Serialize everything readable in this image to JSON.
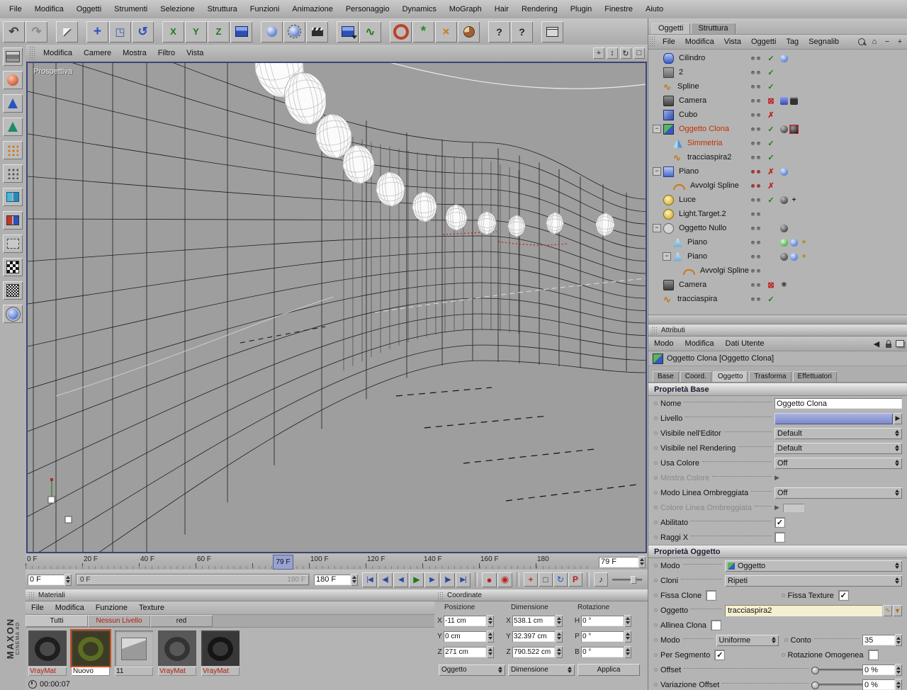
{
  "menubar": {
    "items": [
      "File",
      "Modifica",
      "Oggetti",
      "Strumenti",
      "Selezione",
      "Struttura",
      "Funzioni",
      "Animazione",
      "Personaggio",
      "Dynamics",
      "MoGraph",
      "Hair",
      "Rendering",
      "Plugin",
      "Finestre",
      "Aiuto"
    ]
  },
  "toolbar": {
    "buttons": [
      {
        "name": "undo",
        "glyph": "↶",
        "icon": "",
        "sep": "0"
      },
      {
        "name": "redo",
        "glyph": "↷",
        "icon": "",
        "sep": "0"
      },
      {
        "name": "select-tool",
        "glyph": "◤",
        "icon": "",
        "sep": "1"
      },
      {
        "name": "move-tool",
        "glyph": "+",
        "icon": "",
        "sep": "1"
      },
      {
        "name": "scale-tool",
        "glyph": "◳",
        "icon": "",
        "sep": "0"
      },
      {
        "name": "rotate-tool",
        "glyph": "↺",
        "icon": "",
        "sep": "0"
      },
      {
        "name": "lock-x-axis",
        "glyph": "X",
        "icon": "",
        "sep": "1"
      },
      {
        "name": "lock-y-axis",
        "glyph": "Y",
        "icon": "",
        "sep": "0"
      },
      {
        "name": "lock-z-axis",
        "glyph": "Z",
        "icon": "",
        "sep": "0"
      },
      {
        "name": "coordinate-system",
        "glyph": "",
        "icon": "cube",
        "sep": "0"
      },
      {
        "name": "render-view",
        "glyph": "",
        "icon": "ball",
        "sep": "1"
      },
      {
        "name": "render-region",
        "glyph": "",
        "icon": "ball-frame",
        "sep": "0"
      },
      {
        "name": "render-settings",
        "glyph": "",
        "icon": "clapper",
        "sep": "0"
      },
      {
        "name": "add-primitive",
        "glyph": "",
        "icon": "cube-drop",
        "sep": "1"
      },
      {
        "name": "add-spline",
        "glyph": "∿",
        "icon": "",
        "sep": "0"
      },
      {
        "name": "mograph-cloner",
        "glyph": "",
        "icon": "donut",
        "sep": "1"
      },
      {
        "name": "mograph-array",
        "glyph": "*",
        "icon": "",
        "sep": "0"
      },
      {
        "name": "mograph-symmetry",
        "glyph": "×",
        "icon": "",
        "sep": "0"
      },
      {
        "name": "bake-object",
        "glyph": "",
        "icon": "pie",
        "sep": "0"
      },
      {
        "name": "context-help",
        "glyph": "?",
        "icon": "",
        "sep": "1"
      },
      {
        "name": "annotation",
        "glyph": "?",
        "icon": "",
        "sep": "0"
      },
      {
        "name": "layout-browser",
        "glyph": "",
        "icon": "window",
        "sep": "1"
      }
    ]
  },
  "left_toolbar": {
    "buttons": [
      {
        "name": "make-editable",
        "icon": "panelgrid"
      },
      {
        "name": "model-mode",
        "icon": "ball-red"
      },
      {
        "name": "object-axis-mode",
        "icon": "axis"
      },
      {
        "name": "texture-axis-mode",
        "icon": "axis2"
      },
      {
        "name": "animation-mode",
        "icon": "dots-orange"
      },
      {
        "name": "point-mode",
        "icon": "dots-gray"
      },
      {
        "name": "edge-mode",
        "icon": "sq-cyan"
      },
      {
        "name": "polygon-mode",
        "icon": "sq-redblue"
      },
      {
        "name": "uv-mode",
        "icon": "sq-dotted"
      },
      {
        "name": "texture-mode",
        "icon": "checker"
      },
      {
        "name": "workplane-mode",
        "icon": "checker-sm"
      },
      {
        "name": "selection-filter",
        "icon": "ball-orbit"
      }
    ]
  },
  "viewport": {
    "label": "Prospettiva",
    "menu": [
      "Modifica",
      "Camere",
      "Mostra",
      "Filtro",
      "Vista"
    ],
    "corner_icons": [
      {
        "name": "pan-view-icon",
        "glyph": "+"
      },
      {
        "name": "zoom-view-icon",
        "glyph": "↕"
      },
      {
        "name": "rotate-view-icon",
        "glyph": "↻"
      },
      {
        "name": "maximize-view-icon",
        "glyph": "□"
      }
    ]
  },
  "timeline": {
    "ticks": [
      "0 F",
      "20 F",
      "40 F",
      "60 F",
      "",
      "100 F",
      "120 F",
      "140 F",
      "160 F",
      "180"
    ],
    "playhead_label": "79 F",
    "frame_field": "79 F"
  },
  "transport": {
    "start_field": "0 F",
    "end_field": "180 F",
    "range_start_label": "0 F",
    "range_end_label": "180 F",
    "buttons": [
      {
        "name": "goto-start",
        "glyph": "|◀"
      },
      {
        "name": "prev-key",
        "glyph": "◀|"
      },
      {
        "name": "prev-frame",
        "glyph": "◀"
      },
      {
        "name": "play",
        "glyph": "▶"
      },
      {
        "name": "next-frame",
        "glyph": "▶"
      },
      {
        "name": "next-key",
        "glyph": "|▶"
      },
      {
        "name": "goto-end",
        "glyph": "▶|"
      }
    ],
    "record_buttons": [
      {
        "name": "record-keyframe",
        "glyph": "●"
      },
      {
        "name": "autokeying",
        "glyph": "◉"
      }
    ],
    "key_toggles": [
      {
        "name": "record-position",
        "glyph": "+"
      },
      {
        "name": "record-scale",
        "glyph": "□"
      },
      {
        "name": "record-rotation",
        "glyph": "↻"
      },
      {
        "name": "record-parameter",
        "glyph": "P"
      }
    ],
    "sound_glyph": "♪"
  },
  "object_manager": {
    "tabs": [
      {
        "label": "Oggetti",
        "active": "1"
      },
      {
        "label": "Struttura",
        "active": "0"
      }
    ],
    "menu": [
      "File",
      "Modifica",
      "Vista",
      "Oggetti",
      "Tag",
      "Segnalib"
    ],
    "tree": [
      {
        "indent": 0,
        "expand": "",
        "icon": "cylinder",
        "label": "Cilindro",
        "sel": "0",
        "dots": "gg",
        "mark": "✓",
        "markc": "g",
        "tags": [
          "ball-blue"
        ]
      },
      {
        "indent": 0,
        "expand": "",
        "icon": "generic2",
        "label": "2",
        "sel": "0",
        "dots": "gg",
        "mark": "✓",
        "markc": "g",
        "tags": []
      },
      {
        "indent": 0,
        "expand": "",
        "icon": "spline",
        "label": "Spline",
        "sel": "0",
        "dots": "gg",
        "mark": "✓",
        "markc": "g",
        "tags": []
      },
      {
        "indent": 0,
        "expand": "",
        "icon": "camera",
        "label": "Camera",
        "sel": "0",
        "dots": "gg",
        "mark": "⊠",
        "markc": "r",
        "tags": [
          "display",
          "film"
        ]
      },
      {
        "indent": 0,
        "expand": "",
        "icon": "cube",
        "label": "Cubo",
        "sel": "0",
        "dots": "gg",
        "mark": "✗",
        "markc": "r",
        "tags": []
      },
      {
        "indent": 0,
        "expand": "−",
        "icon": "clone",
        "label": "Oggetto Clona",
        "sel": "1",
        "dots": "gg",
        "mark": "✓",
        "markc": "g",
        "tags": [
          "ball-dark",
          "sel-red"
        ]
      },
      {
        "indent": 1,
        "expand": "",
        "icon": "symmetry",
        "label": "Simmetria",
        "sel": "1",
        "dots": "gg",
        "mark": "✓",
        "markc": "g",
        "tags": []
      },
      {
        "indent": 1,
        "expand": "",
        "icon": "spline",
        "label": "tracciaspira2",
        "sel": "0",
        "dots": "gg",
        "mark": "✓",
        "markc": "g",
        "tags": []
      },
      {
        "indent": 0,
        "expand": "−",
        "icon": "plane",
        "label": "Piano",
        "sel": "0",
        "dots": "rr",
        "mark": "✗",
        "markc": "r",
        "tags": [
          "ball-blue"
        ]
      },
      {
        "indent": 1,
        "expand": "",
        "icon": "wrap",
        "label": "Avvolgi Spline",
        "sel": "0",
        "dots": "rr",
        "mark": "✗",
        "markc": "r",
        "tags": []
      },
      {
        "indent": 0,
        "expand": "",
        "icon": "light",
        "label": "Luce",
        "sel": "0",
        "dots": "gg",
        "mark": "✓",
        "markc": "g",
        "tags": [
          "ball-dark",
          "target"
        ]
      },
      {
        "indent": 0,
        "expand": "",
        "icon": "light",
        "label": "Light.Target.2",
        "sel": "0",
        "dots": "gg",
        "mark": "",
        "markc": "",
        "tags": []
      },
      {
        "indent": 0,
        "expand": "−",
        "icon": "null",
        "label": "Oggetto Nullo",
        "sel": "0",
        "dots": "gg",
        "mark": "",
        "markc": "",
        "tags": [
          "ball-dark"
        ]
      },
      {
        "indent": 1,
        "expand": "",
        "icon": "plane2",
        "label": "Piano",
        "sel": "0",
        "dots": "gg",
        "mark": "",
        "markc": "",
        "tags": [
          "ball-green",
          "ball-blue",
          "star"
        ]
      },
      {
        "indent": 1,
        "expand": "−",
        "icon": "plane2",
        "label": "Piano",
        "sel": "0",
        "dots": "gg",
        "mark": "",
        "markc": "",
        "tags": [
          "ball-dark",
          "ball-blue",
          "star"
        ]
      },
      {
        "indent": 2,
        "expand": "",
        "icon": "wrap",
        "label": "Avvolgi Spline",
        "sel": "0",
        "dots": "gg",
        "mark": "",
        "markc": "",
        "tags": []
      },
      {
        "indent": 0,
        "expand": "",
        "icon": "camera",
        "label": "Camera",
        "sel": "0",
        "dots": "gg",
        "mark": "⊠",
        "markc": "r",
        "tags": [
          "gear"
        ]
      },
      {
        "indent": 0,
        "expand": "",
        "icon": "spline",
        "label": "tracciaspira",
        "sel": "0",
        "dots": "gg",
        "mark": "✓",
        "markc": "g",
        "tags": []
      }
    ]
  },
  "attributes": {
    "panel_title": "Attributi",
    "menu": [
      "Modo",
      "Modifica",
      "Dati Utente"
    ],
    "object_title": "Oggetto Clona [Oggetto Clona]",
    "tabs": [
      {
        "label": "Base",
        "active": "0"
      },
      {
        "label": "Coord.",
        "active": "0"
      },
      {
        "label": "Oggetto",
        "active": "1"
      },
      {
        "label": "Trasforma",
        "active": "0"
      },
      {
        "label": "Effettuatori",
        "active": "0"
      }
    ],
    "base_section": "Proprietà Base",
    "object_section": "Proprietà Oggetto",
    "base": {
      "nome_label": "Nome",
      "nome_value": "Oggetto Clona",
      "livello_label": "Livello",
      "vis_editor_label": "Visibile nell'Editor",
      "vis_editor_value": "Default",
      "vis_render_label": "Visibile nel Rendering",
      "vis_render_value": "Default",
      "usa_colore_label": "Usa Colore",
      "usa_colore_value": "Off",
      "mostra_colore_label": "Mostra Colore",
      "modo_linea_label": "Modo Linea Ombreggiata",
      "modo_linea_value": "Off",
      "colore_linea_label": "Colore Linea Ombreggiata",
      "abilitato_label": "Abilitato",
      "raggi_label": "Raggi X"
    },
    "object": {
      "modo_label": "Modo",
      "modo_value": "Oggetto",
      "cloni_label": "Cloni",
      "cloni_value": "Ripeti",
      "fissa_clone_label": "Fissa Clone",
      "fissa_texture_label": "Fissa Texture",
      "oggetto_label": "Oggetto",
      "oggetto_value": "tracciaspira2",
      "allinea_label": "Allinea Clona",
      "modo2_label": "Modo",
      "modo2_value": "Uniforme",
      "conto_label": "Conto",
      "conto_value": "35",
      "per_segmento_label": "Per Segmento",
      "rotazione_label": "Rotazione Omogenea",
      "offset_label": "Offset",
      "offset_value": "0 %",
      "variazione_label": "Variazione Offset",
      "variazione_value": "0 %"
    }
  },
  "materials": {
    "panel_title": "Materiali",
    "menu": [
      "File",
      "Modifica",
      "Funzione",
      "Texture"
    ],
    "tabs": [
      {
        "label": "Tutti",
        "style": "plain",
        "active": "1"
      },
      {
        "label": "Nessun Livello",
        "style": "red",
        "active": "0"
      },
      {
        "label": "red",
        "style": "plain",
        "active": "0"
      }
    ],
    "items": [
      {
        "name": "VrayMat",
        "thumb": "knot-dark",
        "label_style": "red",
        "selected": "0"
      },
      {
        "name": "Nuovo",
        "thumb": "knot-green",
        "label_style": "plain",
        "selected": "1"
      },
      {
        "name": "11",
        "thumb": "cube",
        "label_style": "plain",
        "selected": "0"
      },
      {
        "name": "VrayMat",
        "thumb": "knot-gray",
        "label_style": "red",
        "selected": "0"
      },
      {
        "name": "VrayMat",
        "thumb": "knot-dark2",
        "label_style": "red",
        "selected": "0"
      }
    ]
  },
  "coordinates": {
    "panel_title": "Coordinate",
    "col1": "Posizione",
    "col2": "Dimensione",
    "col3": "Rotazione",
    "px_label": "X",
    "px": "-11 cm",
    "dx_label": "X",
    "dx": "538.1 cm",
    "rh_label": "H",
    "rh": "0 °",
    "py_label": "Y",
    "py": "0 cm",
    "dy_label": "Y",
    "dy": "32.397 cm",
    "rp_label": "P",
    "rp": "0 °",
    "pz_label": "Z",
    "pz": "271 cm",
    "dz_label": "Z",
    "dz": "790.522 cm",
    "rb_label": "B",
    "rb": "0 °",
    "mode_object": "Oggetto",
    "mode_dimension": "Dimensione",
    "apply": "Applica"
  },
  "statusbar": {
    "time": "00:00:07",
    "brand_top": "MAXON",
    "brand_bottom": "CINEMA 4D"
  }
}
